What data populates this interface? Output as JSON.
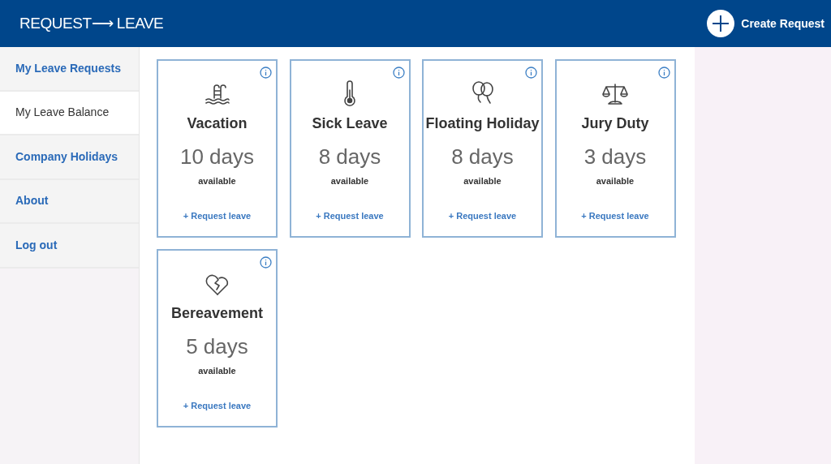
{
  "header": {
    "logo": "REQUEST⟶ LEAVE",
    "create_button": {
      "label": "Create Request"
    }
  },
  "sidebar": {
    "items": [
      {
        "label": "My Leave Requests",
        "selected": false
      },
      {
        "label": "My Leave Balance",
        "selected": true
      },
      {
        "label": "Company Holidays",
        "selected": false
      },
      {
        "label": "About",
        "selected": false
      },
      {
        "label": "Log out",
        "selected": false
      }
    ]
  },
  "cards": [
    {
      "kind": "pool",
      "title": "Vacation",
      "amount": "10 days",
      "caption": "available",
      "link": "+ Request leave"
    },
    {
      "kind": "thermometer",
      "title": "Sick Leave",
      "amount": "8 days",
      "caption": "available",
      "link": "+ Request leave"
    },
    {
      "kind": "balloons",
      "title": "Floating Holiday",
      "amount": "8 days",
      "caption": "available",
      "link": "+ Request leave"
    },
    {
      "kind": "scales",
      "title": "Jury Duty",
      "amount": "3 days",
      "caption": "available",
      "link": "+ Request leave"
    },
    {
      "kind": "heartbreak",
      "title": "Bereavement",
      "amount": "5 days",
      "caption": "available",
      "link": "+ Request leave"
    }
  ]
}
